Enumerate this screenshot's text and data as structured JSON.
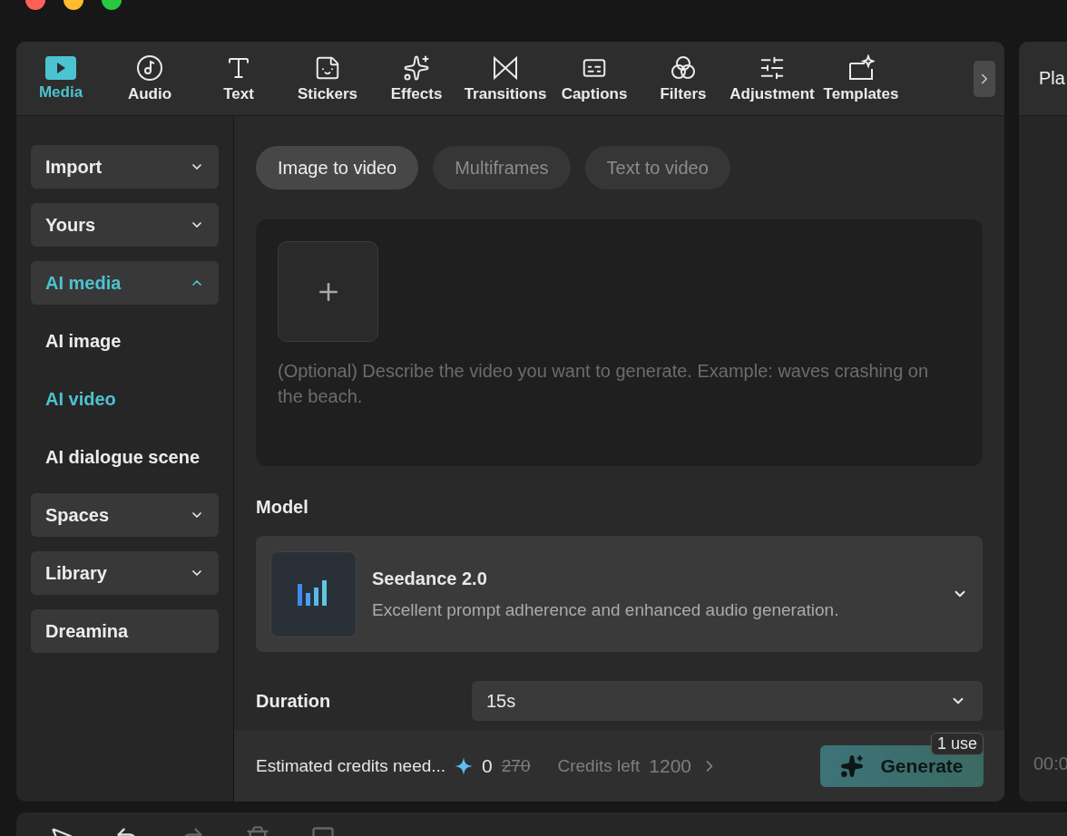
{
  "toolbar": {
    "tabs": [
      {
        "kind": "media",
        "label": "Media",
        "selected": true
      },
      {
        "kind": "audio",
        "label": "Audio",
        "selected": false
      },
      {
        "kind": "text",
        "label": "Text",
        "selected": false
      },
      {
        "kind": "stickers",
        "label": "Stickers",
        "selected": false
      },
      {
        "kind": "effects",
        "label": "Effects",
        "selected": false
      },
      {
        "kind": "transitions",
        "label": "Transitions",
        "selected": false
      },
      {
        "kind": "captions",
        "label": "Captions",
        "selected": false
      },
      {
        "kind": "filters",
        "label": "Filters",
        "selected": false
      },
      {
        "kind": "adjustment",
        "label": "Adjustment",
        "selected": false
      },
      {
        "kind": "templates",
        "label": "Templates",
        "selected": false
      }
    ]
  },
  "sidebar": {
    "items": [
      {
        "kind": "section",
        "label": "Import",
        "expanded": false,
        "selected": false
      },
      {
        "kind": "section",
        "label": "Yours",
        "expanded": false,
        "selected": false
      },
      {
        "kind": "section",
        "label": "AI media",
        "expanded": true,
        "selected": true
      },
      {
        "kind": "sub",
        "label": "AI image",
        "selected": false
      },
      {
        "kind": "sub",
        "label": "AI video",
        "selected": true
      },
      {
        "kind": "sub",
        "label": "AI dialogue scene",
        "selected": false
      },
      {
        "kind": "section",
        "label": "Spaces",
        "expanded": false,
        "selected": false
      },
      {
        "kind": "section",
        "label": "Library",
        "expanded": false,
        "selected": false
      },
      {
        "kind": "entry",
        "label": "Dreamina",
        "selected": false
      }
    ]
  },
  "mode_tabs": [
    {
      "label": "Image to video",
      "selected": true
    },
    {
      "label": "Multiframes",
      "selected": false
    },
    {
      "label": "Text to video",
      "selected": false
    }
  ],
  "prompt": {
    "placeholder": "(Optional) Describe the video you want to generate. Example: waves crashing on the beach."
  },
  "model": {
    "label": "Model",
    "name": "Seedance 2.0",
    "description": "Excellent prompt adherence and enhanced audio generation."
  },
  "duration": {
    "label": "Duration",
    "value": "15s"
  },
  "footer": {
    "estimate_label": "Estimated credits need...",
    "cost": "0",
    "original_cost": "270",
    "credits_label": "Credits left",
    "credits": "1200",
    "generate": {
      "label": "Generate",
      "disabled": true,
      "badge": "1 use"
    }
  },
  "preview": {
    "title": "Pla",
    "timecode": "00:0"
  }
}
